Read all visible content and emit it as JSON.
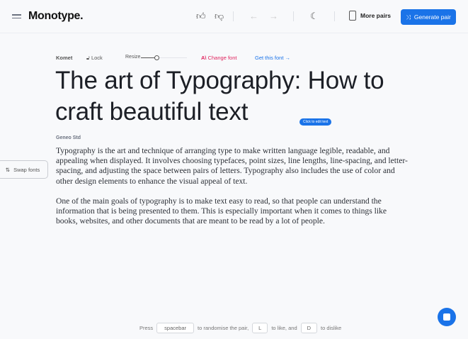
{
  "header": {
    "logo": "Monotype.",
    "more_pairs": "More pairs",
    "generate": "Generate pair"
  },
  "toolbar": {
    "font_name": "Komet",
    "lock": "Lock",
    "resize": "Resize",
    "resize_value": 0.3,
    "change_font": "Change font",
    "get_font": "Get this font →"
  },
  "heading": {
    "text": "The art of Typography: How to craft beautiful text",
    "edit_hint": "Click to edit text"
  },
  "body_font": "Geneo Std",
  "paragraphs": [
    "Typography is the art and technique of arranging type to make written language legible, readable, and appealing when displayed. It involves choosing typefaces, point sizes, line lengths, line-spacing, and letter-spacing, and adjusting the space between pairs of letters. Typography also includes the use of color and other design elements to enhance the visual appeal of text.",
    "One of the main goals of typography is to make text easy to read, so that people can understand the information that is being presented to them. This is especially important when it comes to things like books, websites, and other documents that are meant to be read by a lot of people."
  ],
  "swap": "Swap fonts",
  "footer": {
    "press": "Press",
    "k1": "spacebar",
    "t1": "to randomise the pair,",
    "k2": "L",
    "t2": "to like, and",
    "k3": "D",
    "t3": "to dislike"
  },
  "colors": {
    "accent": "#1a73e8",
    "change_font": "#e0245e"
  }
}
